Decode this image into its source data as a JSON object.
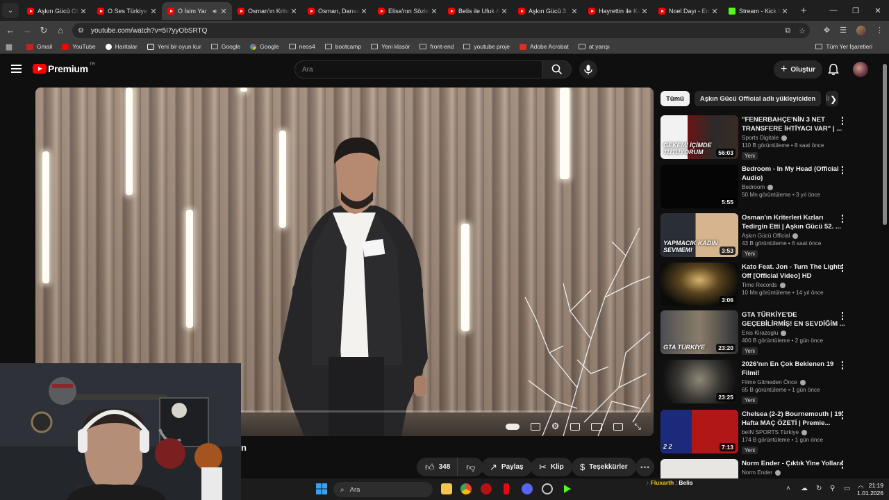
{
  "browser": {
    "tabs": [
      {
        "title": "Aşkın Gücü Offi",
        "active": false
      },
      {
        "title": "O Ses Türkiye Y",
        "active": false
      },
      {
        "title": "O İsim Yar",
        "active": true
      },
      {
        "title": "Osman'ın Krite",
        "active": false
      },
      {
        "title": "Osman, Dansa",
        "active": false
      },
      {
        "title": "Elisa'nın Sözlen",
        "active": false
      },
      {
        "title": "Belis ile Ufuk A",
        "active": false
      },
      {
        "title": "Aşkın Gücü 3. S",
        "active": false
      },
      {
        "title": "Hayrettin ile Ka",
        "active": false
      },
      {
        "title": "Noel Dayı - Em",
        "active": false
      },
      {
        "title": "Stream - Kick D",
        "active": false
      }
    ],
    "url": "youtube.com/watch?v=5I7yyObSRTQ",
    "bookmarks": [
      {
        "label": "Gmail",
        "icon": "gmail-icon"
      },
      {
        "label": "YouTube",
        "icon": "youtube-icon"
      },
      {
        "label": "Haritalar",
        "icon": "maps-icon"
      },
      {
        "label": "Yeni bir oyun kur",
        "icon": "game-icon"
      },
      {
        "label": "Google",
        "icon": "folder-icon"
      },
      {
        "label": "Google",
        "icon": "google-icon"
      },
      {
        "label": "neos4",
        "icon": "folder-icon"
      },
      {
        "label": "bootcamp",
        "icon": "folder-icon"
      },
      {
        "label": "Yeni klasör",
        "icon": "folder-icon"
      },
      {
        "label": "front-end",
        "icon": "folder-icon"
      },
      {
        "label": "youtube proje",
        "icon": "folder-icon"
      },
      {
        "label": "Adobe Acrobat",
        "icon": "pdf-icon"
      },
      {
        "label": "at yarışı",
        "icon": "folder-icon"
      }
    ],
    "all_bookmarks": "Tüm Yer İşaretleri"
  },
  "youtube": {
    "logo_text": "Premium",
    "logo_region": "TR",
    "search_placeholder": "Ara",
    "create_label": "Oluştur",
    "video_title_fragment": "n",
    "actions": {
      "likes": "348",
      "share": "Paylaş",
      "clip": "Klip",
      "thanks": "Teşekkürler"
    },
    "chips": [
      "Tümü",
      "Aşkın Gücü Official adlı yükleyiciden",
      "İl"
    ],
    "recommendations": [
      {
        "title": "\"FENERBAHÇE'NİN 3 NET TRANSFERE İHTİYACI VAR\" | ...",
        "channel": "Sports Digitale",
        "views": "110 B görüntüleme",
        "age": "8 saat önce",
        "badge": "Yeni",
        "duration": "56:03",
        "thumb_text": "GEKEMİ İÇİMDE TUTUYORUM"
      },
      {
        "title": "Bedroom - In My Head (Official Audio)",
        "channel": "Bedroom",
        "views": "50 Mn görüntüleme",
        "age": "3 yıl önce",
        "badge": "",
        "duration": "5:55",
        "thumb_text": ""
      },
      {
        "title": "Osman'ın Kriterleri Kızları Tedirgin Etti | Aşkın Gücü 52. ...",
        "channel": "Aşkın Gücü Official",
        "views": "43 B görüntüleme",
        "age": "6 saat önce",
        "badge": "Yeni",
        "duration": "3:53",
        "thumb_text": "YAPMACIK KADIN SEVMEM!"
      },
      {
        "title": "Kato Feat. Jon - Turn The Lights Off [Official Video] HD",
        "channel": "Time Records",
        "views": "10 Mn görüntüleme",
        "age": "14 yıl önce",
        "badge": "",
        "duration": "3:06",
        "thumb_text": ""
      },
      {
        "title": "GTA TÜRKİYE'DE GEÇEBİLİRMİŞ! EN SEVDİĞİM ...",
        "channel": "Enis Kirazoglu",
        "views": "400 B görüntüleme",
        "age": "2 gün önce",
        "badge": "Yeni",
        "duration": "23:20",
        "thumb_text": "GTA TÜRKİYE"
      },
      {
        "title": "2026'nın En Çok Beklenen 19 Filmi!",
        "channel": "Filme Gitmeden Önce",
        "views": "65 B görüntüleme",
        "age": "1 gün önce",
        "badge": "Yeni",
        "duration": "23:25",
        "thumb_text": ""
      },
      {
        "title": "Chelsea (2-2) Bournemouth | 19. Hafta MAÇ ÖZETİ | Premie...",
        "channel": "beIN SPORTS Türkiye",
        "views": "174 B görüntüleme",
        "age": "1 gün önce",
        "badge": "Yeni",
        "duration": "7:13",
        "thumb_text": "2 2"
      },
      {
        "title": "Norm Ender - Çıktık Yine Yollara",
        "channel": "Norm Ender",
        "views": "",
        "age": "",
        "badge": "",
        "duration": "",
        "thumb_text": ""
      }
    ]
  },
  "taskbar": {
    "search_placeholder": "Ara",
    "now_playing_app": "Fluxarth",
    "now_playing_title": "Belis",
    "time": "21:19",
    "date": "1.01.2026"
  },
  "colors": {
    "accent": "#ff0000",
    "bg": "#0f0f0f",
    "kick": "#53fc18"
  }
}
